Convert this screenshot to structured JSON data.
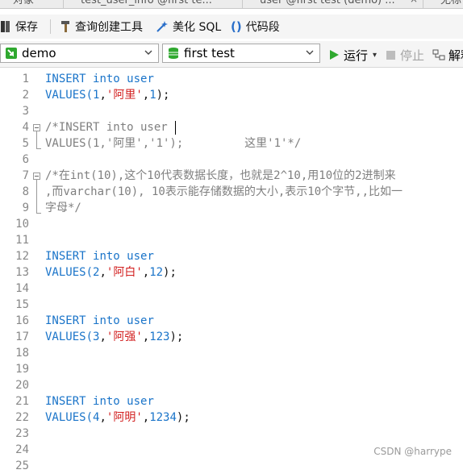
{
  "tabs": [
    {
      "label": "对象"
    },
    {
      "label": "test_user_info @first te..."
    },
    {
      "label": "user @first test (demo) ..."
    },
    {
      "label": "无标"
    }
  ],
  "toolbar": {
    "save": "保存",
    "query_builder": "查询创建工具",
    "beautify": "美化 SQL",
    "snippet": "代码段"
  },
  "selectors": {
    "connection": "demo",
    "database": "first test",
    "run": "运行",
    "stop": "停止",
    "explain": "解释"
  },
  "editor": {
    "line_numbers": [
      "1",
      "2",
      "3",
      "4",
      "5",
      "6",
      "7",
      "8",
      "9",
      "10",
      "11",
      "12",
      "13",
      "14",
      "15",
      "16",
      "17",
      "18",
      "19",
      "20",
      "21",
      "22",
      "23",
      "24",
      "25"
    ],
    "l1": [
      "INSERT",
      "into",
      "user"
    ],
    "l2": {
      "fn": "VALUES(",
      "a": "1",
      "b": ",",
      "s": "'阿里'",
      "c": ",",
      "d": "1",
      "e": ");"
    },
    "l4": "/*INSERT into user",
    "l5": "VALUES(1,'阿里','1');         这里'1'*/",
    "l7": "/*在int(10),这个10代表数据长度，也就是2^10,用10位的2进制来",
    "l8": ",而varchar(10), 10表示能存储数据的大小,表示10个字节,,比如一",
    "l9": "字母*/",
    "l12": [
      "INSERT",
      "into",
      "user"
    ],
    "l13": {
      "fn": "VALUES(",
      "a": "2",
      "b": ",",
      "s": "'阿白'",
      "c": ",",
      "d": "12",
      "e": ");"
    },
    "l16": [
      "INSERT",
      "into",
      "user"
    ],
    "l17": {
      "fn": "VALUES(",
      "a": "3",
      "b": ",",
      "s": "'阿强'",
      "c": ",",
      "d": "123",
      "e": ");"
    },
    "l21": [
      "INSERT",
      "into",
      "user"
    ],
    "l22": {
      "fn": "VALUES(",
      "a": "4",
      "b": ",",
      "s": "'阿明'",
      "c": ",",
      "d": "1234",
      "e": ");"
    }
  },
  "watermark": "CSDN @harrype",
  "colors": {
    "keyword": "#1a74c9",
    "string": "#d21f1f",
    "comment": "#7f7f7f",
    "run_green": "#2fa82f"
  }
}
